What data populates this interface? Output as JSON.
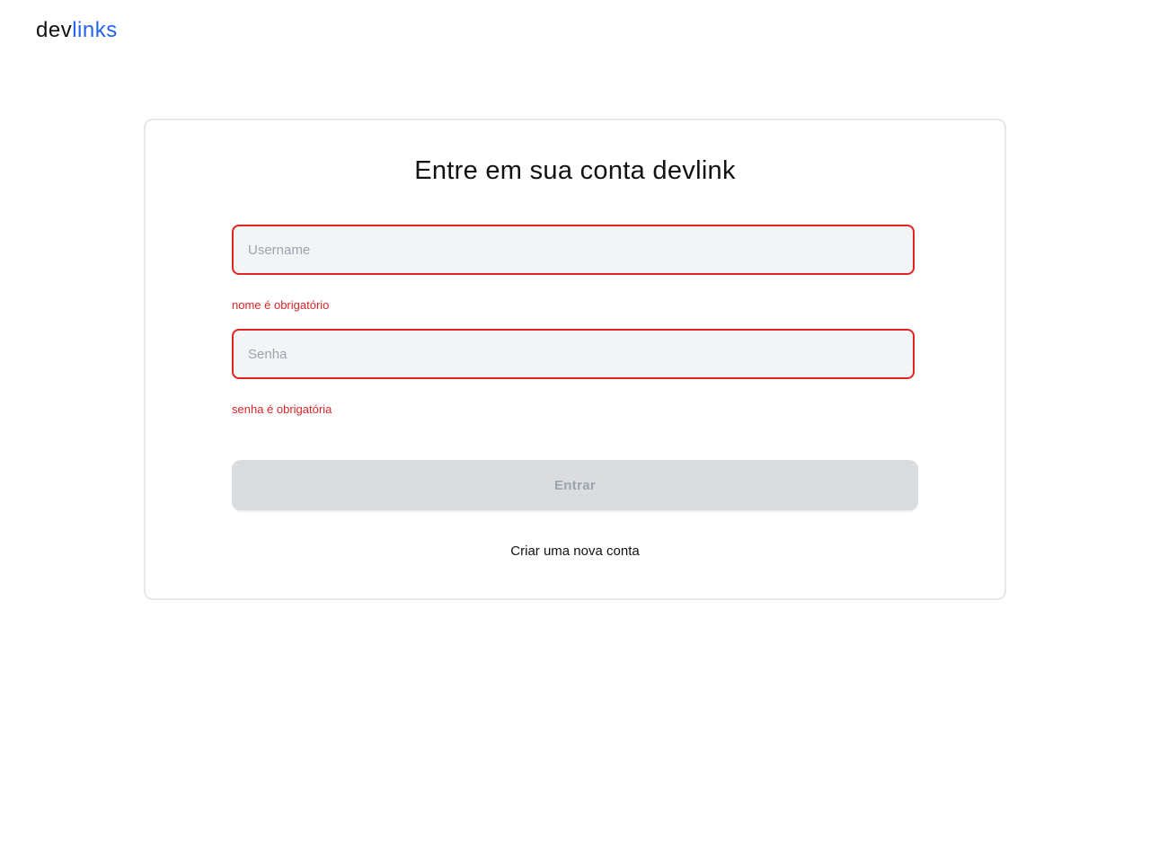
{
  "header": {
    "logo_prefix": "dev",
    "logo_suffix": "links"
  },
  "form": {
    "title": "Entre em sua conta devlink",
    "username": {
      "placeholder": "Username",
      "value": "",
      "error": "nome é obrigatório"
    },
    "password": {
      "placeholder": "Senha",
      "value": "",
      "error": "senha é obrigatória"
    },
    "submit_label": "Entrar",
    "signup_link": "Criar uma nova conta"
  },
  "colors": {
    "accent": "#2563eb",
    "error": "#dc2626",
    "input_bg": "#f3f4f6",
    "button_disabled_bg": "#dadde0"
  }
}
